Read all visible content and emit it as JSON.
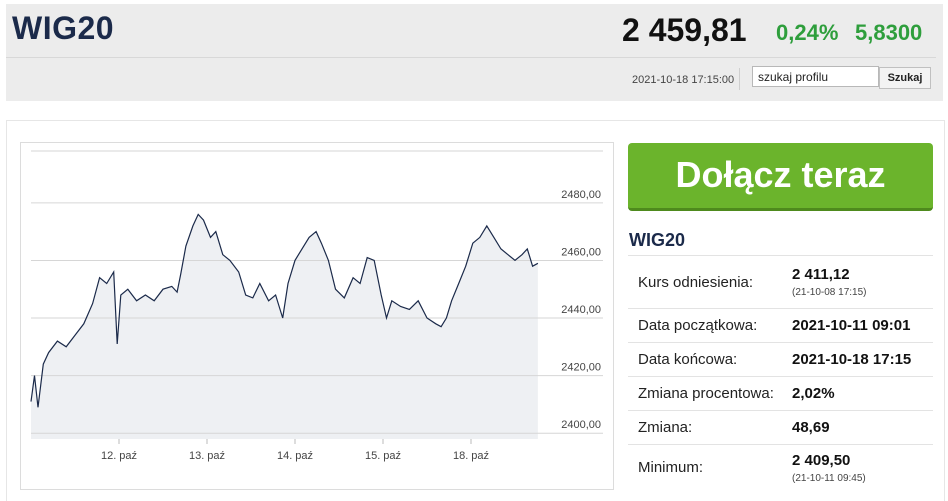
{
  "header": {
    "ticker": "WIG20",
    "price": "2 459,81",
    "change_percent": "0,24%",
    "change_value": "5,8300",
    "timestamp": "2021-10-18 17:15:00",
    "search_placeholder": "szukaj profilu",
    "search_value": "szukaj profilu",
    "search_button": "Szukaj",
    "colors": {
      "positive": "#2e9e3c",
      "ticker": "#1b2a4a"
    }
  },
  "cta": {
    "label": "Dołącz teraz",
    "color": "#6bb42c"
  },
  "info": {
    "title": "WIG20",
    "rows": [
      {
        "label": "Kurs odniesienia:",
        "value": "2 411,12",
        "sub": "(21-10-08 17:15)"
      },
      {
        "label": "Data początkowa:",
        "value": "2021-10-11 09:01",
        "sub": ""
      },
      {
        "label": "Data końcowa:",
        "value": "2021-10-18 17:15",
        "sub": ""
      },
      {
        "label": "Zmiana procentowa:",
        "value": "2,02%",
        "sub": ""
      },
      {
        "label": "Zmiana:",
        "value": "48,69",
        "sub": ""
      },
      {
        "label": "Minimum:",
        "value": "2 409,50",
        "sub": "(21-10-11 09:45)"
      }
    ]
  },
  "chart_data": {
    "type": "area",
    "x_ticks": [
      {
        "label": "12. paź",
        "t": 1
      },
      {
        "label": "13. paź",
        "t": 2
      },
      {
        "label": "14. paź",
        "t": 3
      },
      {
        "label": "15. paź",
        "t": 4
      },
      {
        "label": "18. paź",
        "t": 5
      }
    ],
    "y_ticks": [
      {
        "label": "2400,00",
        "v": 2400
      },
      {
        "label": "2420,00",
        "v": 2420
      },
      {
        "label": "2440,00",
        "v": 2440
      },
      {
        "label": "2460,00",
        "v": 2460
      },
      {
        "label": "2480,00",
        "v": 2480
      }
    ],
    "ylim": [
      2398,
      2498
    ],
    "xlim": [
      0,
      6
    ],
    "grid": true,
    "line_color": "#1b2a4a",
    "fill_color": "#eef0f3",
    "series": [
      {
        "values": [
          [
            0.0,
            2411
          ],
          [
            0.04,
            2420
          ],
          [
            0.08,
            2409
          ],
          [
            0.14,
            2424
          ],
          [
            0.2,
            2428
          ],
          [
            0.3,
            2432
          ],
          [
            0.4,
            2430
          ],
          [
            0.5,
            2434
          ],
          [
            0.6,
            2438
          ],
          [
            0.7,
            2445
          ],
          [
            0.78,
            2454
          ],
          [
            0.86,
            2452
          ],
          [
            0.94,
            2456
          ],
          [
            0.98,
            2431
          ],
          [
            1.02,
            2448
          ],
          [
            1.1,
            2450
          ],
          [
            1.2,
            2446
          ],
          [
            1.3,
            2448
          ],
          [
            1.4,
            2446
          ],
          [
            1.5,
            2450
          ],
          [
            1.6,
            2451
          ],
          [
            1.66,
            2449
          ],
          [
            1.7,
            2455
          ],
          [
            1.76,
            2465
          ],
          [
            1.84,
            2472
          ],
          [
            1.9,
            2476
          ],
          [
            1.96,
            2474
          ],
          [
            2.04,
            2468
          ],
          [
            2.1,
            2470
          ],
          [
            2.18,
            2462
          ],
          [
            2.26,
            2460
          ],
          [
            2.36,
            2456
          ],
          [
            2.44,
            2448
          ],
          [
            2.52,
            2447
          ],
          [
            2.6,
            2452
          ],
          [
            2.7,
            2446
          ],
          [
            2.78,
            2448
          ],
          [
            2.86,
            2440
          ],
          [
            2.92,
            2452
          ],
          [
            3.0,
            2460
          ],
          [
            3.08,
            2464
          ],
          [
            3.16,
            2468
          ],
          [
            3.24,
            2470
          ],
          [
            3.3,
            2466
          ],
          [
            3.38,
            2460
          ],
          [
            3.46,
            2450
          ],
          [
            3.56,
            2447
          ],
          [
            3.66,
            2454
          ],
          [
            3.74,
            2452
          ],
          [
            3.82,
            2461
          ],
          [
            3.9,
            2460
          ],
          [
            3.98,
            2448
          ],
          [
            4.04,
            2440
          ],
          [
            4.1,
            2446
          ],
          [
            4.2,
            2444
          ],
          [
            4.3,
            2443
          ],
          [
            4.4,
            2446
          ],
          [
            4.5,
            2440
          ],
          [
            4.6,
            2438
          ],
          [
            4.66,
            2437
          ],
          [
            4.72,
            2440
          ],
          [
            4.78,
            2446
          ],
          [
            4.86,
            2452
          ],
          [
            4.94,
            2458
          ],
          [
            5.02,
            2466
          ],
          [
            5.1,
            2468
          ],
          [
            5.18,
            2472
          ],
          [
            5.26,
            2468
          ],
          [
            5.34,
            2464
          ],
          [
            5.42,
            2462
          ],
          [
            5.5,
            2460
          ],
          [
            5.58,
            2462
          ],
          [
            5.64,
            2464
          ],
          [
            5.7,
            2458
          ],
          [
            5.76,
            2459
          ]
        ]
      }
    ]
  }
}
